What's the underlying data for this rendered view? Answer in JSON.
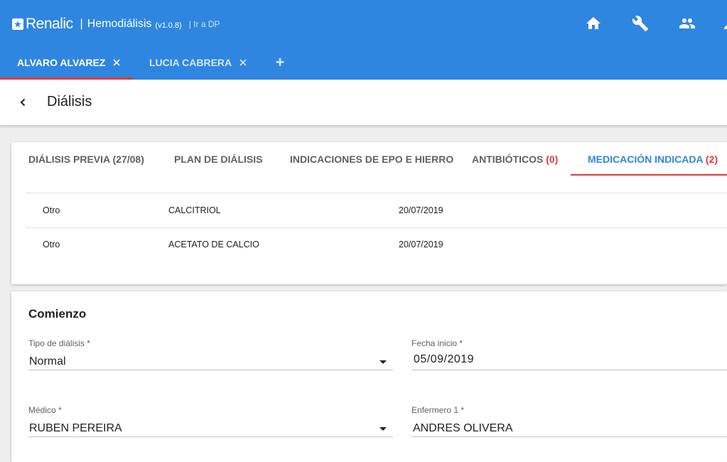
{
  "header": {
    "brand": "Renalic",
    "separator": "|",
    "app_name": "Hemodiálisis",
    "version": "(v1.0.8)",
    "link": "| Ir a DP",
    "icons": [
      "home-icon",
      "wrench-icon",
      "people-icon",
      "account-icon"
    ]
  },
  "patient_tabs": [
    {
      "label": "ALVARO ALVAREZ",
      "active": true
    },
    {
      "label": "LUCIA CABRERA",
      "active": false
    }
  ],
  "add_tab_label": "+",
  "page": {
    "title": "Diálisis"
  },
  "detail_tabs": [
    {
      "label": "DIÁLISIS PREVIA (27/08)",
      "count": ""
    },
    {
      "label": "PLAN DE DIÁLISIS",
      "count": ""
    },
    {
      "label": "INDICACIONES DE EPO E HIERRO",
      "count": ""
    },
    {
      "label": "ANTIBIÓTICOS ",
      "count": "(0)"
    },
    {
      "label": "MEDICACIÓN INDICADA ",
      "count": "(2)",
      "active": true
    }
  ],
  "medications": [
    {
      "type": "Otro",
      "name": "CALCITRIOL",
      "date": "20/07/2019"
    },
    {
      "type": "Otro",
      "name": "ACETATO DE CALCIO",
      "date": "20/07/2019"
    }
  ],
  "form": {
    "section_title": "Comienzo",
    "tipo_dialisis": {
      "label": "Tipo de diálisis *",
      "value": "Normal"
    },
    "fecha_inicio": {
      "label": "Fecha inicio *",
      "value": "05/09/2019"
    },
    "medico": {
      "label": "Médico *",
      "value": "RUBEN PEREIRA"
    },
    "enfermero1": {
      "label": "Enfermero 1 *",
      "value": "ANDRES OLIVERA"
    }
  },
  "colors": {
    "primary": "#2f86e0",
    "accent": "#e53935"
  }
}
